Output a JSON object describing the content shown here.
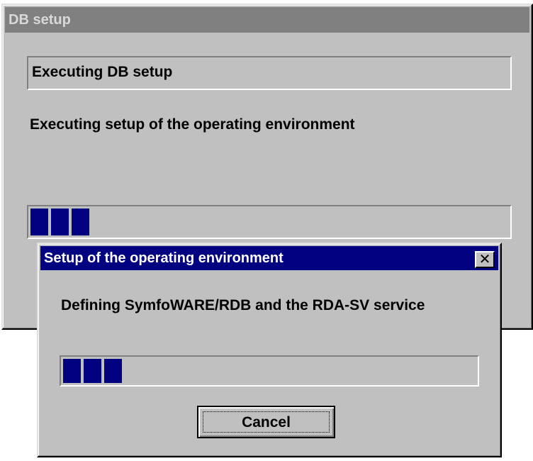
{
  "main_window": {
    "title": "DB setup",
    "status_text": "Executing DB setup",
    "message": "Executing setup of the operating environment",
    "progress_blocks": 3
  },
  "dialog": {
    "title": "Setup of the operating environment",
    "close_label": "✕",
    "message": "Defining SymfoWARE/RDB and the RDA-SV service",
    "progress_blocks": 3,
    "cancel_label": "Cancel"
  },
  "colors": {
    "active_title": "#000080",
    "inactive_title": "#808080",
    "progress_fill": "#000080",
    "window_face": "#c0c0c0"
  }
}
